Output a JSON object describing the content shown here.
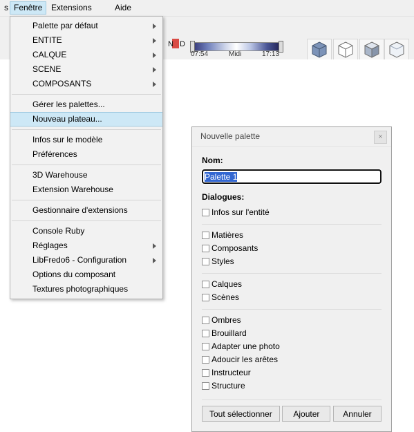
{
  "menubar": {
    "left_partial": "s",
    "items": [
      {
        "label": "Fenêtre",
        "selected": true
      },
      {
        "label": "Extensions",
        "selected": false
      },
      {
        "label": "Aide",
        "selected": false
      }
    ]
  },
  "toolbar": {
    "shadow_widget": {
      "left_letter": "N",
      "right_letter": "D",
      "start_time": "07:54",
      "middle_label": "Midi",
      "end_time": "17:13"
    },
    "geometry_icons": [
      "cube-icon",
      "cube-wireframe-icon",
      "cube-shaded-icon",
      "cube-xray-icon",
      "cube-monochrome-icon"
    ]
  },
  "dropdown": {
    "items": [
      {
        "label": "Palette par défaut",
        "submenu": true,
        "highlight": false
      },
      {
        "label": "ENTITE",
        "submenu": true,
        "highlight": false
      },
      {
        "label": "CALQUE",
        "submenu": true,
        "highlight": false
      },
      {
        "label": "SCENE",
        "submenu": true,
        "highlight": false
      },
      {
        "label": "COMPOSANTS",
        "submenu": true,
        "highlight": false
      },
      {
        "separator": true
      },
      {
        "label": "Gérer les palettes...",
        "submenu": false,
        "highlight": false
      },
      {
        "label": "Nouveau plateau...",
        "submenu": false,
        "highlight": true
      },
      {
        "separator": true
      },
      {
        "label": "Infos sur le modèle",
        "submenu": false,
        "highlight": false
      },
      {
        "label": "Préférences",
        "submenu": false,
        "highlight": false
      },
      {
        "separator": true
      },
      {
        "label": "3D Warehouse",
        "submenu": false,
        "highlight": false
      },
      {
        "label": "Extension Warehouse",
        "submenu": false,
        "highlight": false
      },
      {
        "separator": true
      },
      {
        "label": "Gestionnaire d'extensions",
        "submenu": false,
        "highlight": false
      },
      {
        "separator": true
      },
      {
        "label": "Console Ruby",
        "submenu": false,
        "highlight": false
      },
      {
        "label": "Réglages",
        "submenu": true,
        "highlight": false
      },
      {
        "label": "LibFredo6 - Configuration",
        "submenu": true,
        "highlight": false
      },
      {
        "label": "Options du composant",
        "submenu": false,
        "highlight": false
      },
      {
        "label": "Textures photographiques",
        "submenu": false,
        "highlight": false
      }
    ]
  },
  "dialog": {
    "title": "Nouvelle palette",
    "close_label": "×",
    "name_label": "Nom:",
    "name_value": "Palette 1",
    "dialogues_label": "Dialogues:",
    "groups": [
      [
        "Infos sur l'entité"
      ],
      [
        "Matières",
        "Composants",
        "Styles"
      ],
      [
        "Calques",
        "Scènes"
      ],
      [
        "Ombres",
        "Brouillard",
        "Adapter une photo",
        "Adoucir les arêtes",
        "Instructeur",
        "Structure"
      ]
    ],
    "buttons": {
      "select_all": "Tout sélectionner",
      "add": "Ajouter",
      "cancel": "Annuler"
    }
  }
}
